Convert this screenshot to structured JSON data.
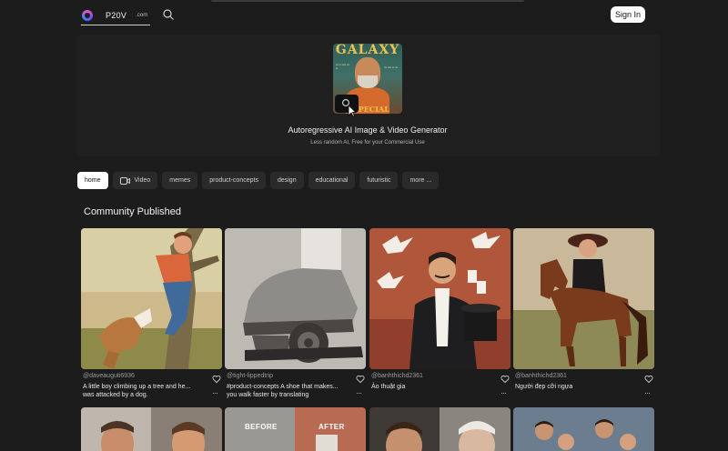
{
  "header": {
    "brand_name": "P20V",
    "brand_tld": ".com",
    "signin_label": "Sign In"
  },
  "hero": {
    "cover_title": "GALAXY",
    "cover_issue": "SPECIAL ISSUE",
    "title": "Autoregressive AI Image & Video Generator",
    "subtitle": "Less random AI, Free for your Commercial Use"
  },
  "tabs": [
    {
      "label": "home",
      "active": true
    },
    {
      "label": "Video",
      "icon": "video-camera-icon"
    },
    {
      "label": "memes"
    },
    {
      "label": "product-concepts"
    },
    {
      "label": "design"
    },
    {
      "label": "educational"
    },
    {
      "label": "futuristic"
    },
    {
      "label": "more ..."
    }
  ],
  "section": {
    "title": "Community Published"
  },
  "cards": [
    {
      "author": "@daveauguti6936",
      "caption": "A little boy climbing up a tree and he...\nwas attacked by a dog."
    },
    {
      "author": "@tight-lippedtrip",
      "caption": "#product-concepts A shoe that makes...\nyou walk faster by translating"
    },
    {
      "author": "@banhthichd2361",
      "caption": "Ảo thuật gia"
    },
    {
      "author": "@banhthichd2361",
      "caption": "Người đẹp cỡi ngựa"
    }
  ],
  "row2": {
    "before_label": "BEFORE",
    "after_label": "AFTER"
  },
  "colors": {
    "background": "#1c1c1c",
    "surface": "#2a2a2a",
    "active_tab": "#ffffff"
  }
}
